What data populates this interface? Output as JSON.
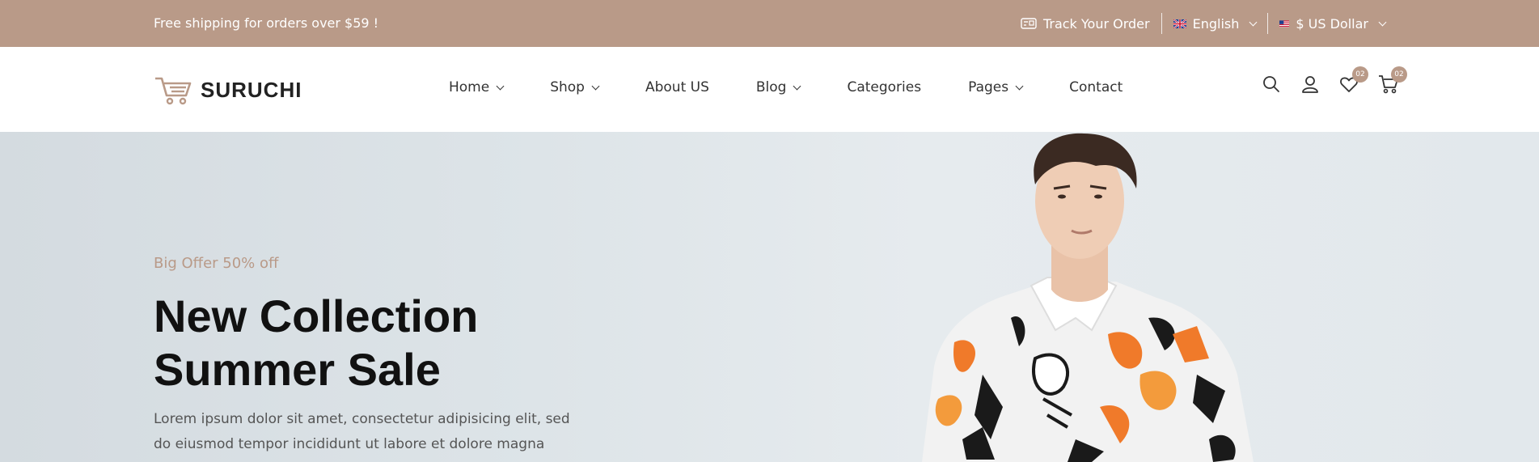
{
  "topbar": {
    "shipping": "Free shipping for orders over $59 !",
    "track_order": "Track Your Order",
    "language": "English",
    "currency": "$ US Dollar"
  },
  "logo": {
    "text": "SURUCHI"
  },
  "nav": {
    "items": [
      {
        "label": "Home",
        "dropdown": true
      },
      {
        "label": "Shop",
        "dropdown": true
      },
      {
        "label": "About US",
        "dropdown": false
      },
      {
        "label": "Blog",
        "dropdown": true
      },
      {
        "label": "Categories",
        "dropdown": false
      },
      {
        "label": "Pages",
        "dropdown": true
      },
      {
        "label": "Contact",
        "dropdown": false
      }
    ]
  },
  "tools": {
    "wishlist_count": "02",
    "cart_count": "02"
  },
  "hero": {
    "offer": "Big Offer 50% off",
    "title_line1": "New Collection",
    "title_line2": "Summer Sale",
    "description": "Lorem ipsum dolor sit amet, consectetur adipisicing elit, sed do eiusmod tempor incididunt ut labore et dolore magna"
  },
  "colors": {
    "accent": "#b99a88",
    "hero_bg": "#dde4e8"
  }
}
